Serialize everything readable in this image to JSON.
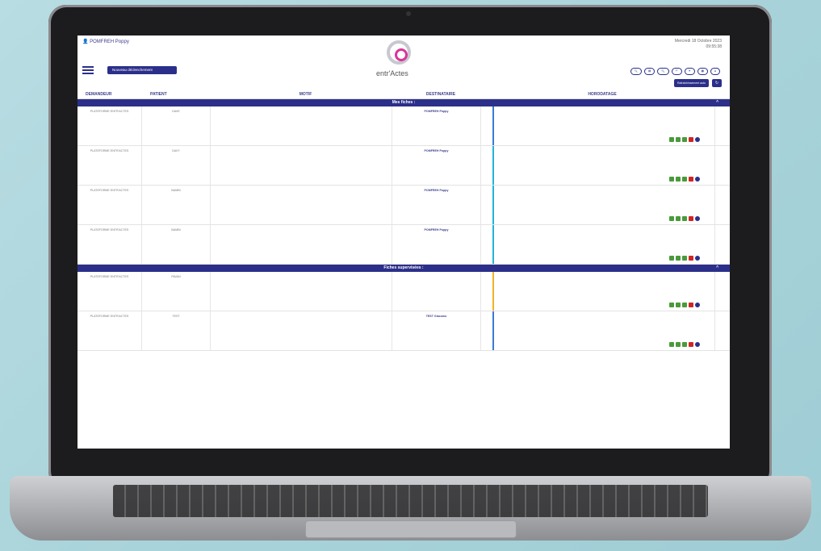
{
  "header": {
    "user": "POMFREH Poppy",
    "date_line1": "Mercredi 18 Octobre 2023",
    "date_line2": "09:55:38",
    "new_button": "Nouveau déclenchement",
    "brand": "entr'Actes",
    "refresh_button": "Rafraîchissement auto"
  },
  "columns": [
    "DEMANDEUR",
    "PATIENT",
    "MOTIF",
    "DESTINATAIRE",
    "HORODATAGE"
  ],
  "sections": {
    "mine": "Mes fiches :",
    "supervised": "Fiches supervisées :"
  },
  "rows": [
    {
      "demandeur": "PLATEFORME ENTR'ACTES",
      "patient": "DAVE",
      "dest": "POMFREH Poppy",
      "color": "#3a7bd5"
    },
    {
      "demandeur": "PLATEFORME ENTR'ACTES",
      "patient": "DAVY",
      "dest": "POMFREH Poppy",
      "color": "#23b4d8"
    },
    {
      "demandeur": "PLATEFORME ENTR'ACTES",
      "patient": "BAMBI",
      "dest": "POMFREH Poppy",
      "color": "#23b4d8"
    },
    {
      "demandeur": "PLATEFORME ENTR'ACTES",
      "patient": "BAMBI",
      "dest": "POMFREH Poppy",
      "color": "#23b4d8"
    }
  ],
  "supervised_rows": [
    {
      "demandeur": "PLATEFORME ENTR'ACTES",
      "patient": "PAVAN",
      "dest": "",
      "color": "#f0b429"
    },
    {
      "demandeur": "PLATEFORME ENTR'ACTES",
      "patient": "TEST",
      "dest": "TEST Giacomo",
      "color": "#3a7bd5"
    }
  ]
}
